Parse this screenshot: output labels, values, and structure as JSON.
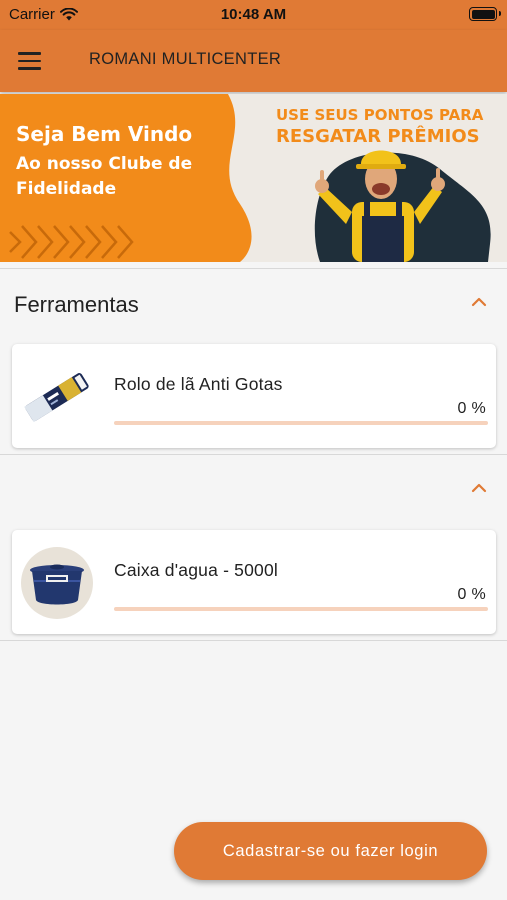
{
  "status_bar": {
    "carrier": "Carrier",
    "time": "10:48 AM"
  },
  "app_bar": {
    "title": "ROMANI MULTICENTER",
    "menu_icon": "hamburger-menu-icon"
  },
  "banner": {
    "left_line1": "Seja Bem Vindo",
    "left_line2": "Ao nosso Clube de",
    "left_line3": "Fidelidade",
    "right_line1": "USE SEUS PONTOS PARA",
    "right_line2": "RESGATAR PRÊMIOS",
    "colors": {
      "orange": "#f28b1a",
      "dark": "#1f2f3a",
      "bg": "#eeeae4"
    }
  },
  "sections": [
    {
      "title": "Ferramentas",
      "expanded_icon": "chevron-up-icon",
      "items": [
        {
          "name": "Rolo de lã Anti Gotas",
          "percent_label": "0 %",
          "progress": 0,
          "image": "paint-roller-package"
        }
      ]
    },
    {
      "title": "",
      "expanded_icon": "chevron-up-icon",
      "items": [
        {
          "name": "Caixa d'agua - 5000l",
          "percent_label": "0 %",
          "progress": 0,
          "image": "water-tank"
        }
      ]
    }
  ],
  "fab": {
    "label": "Cadastrar-se ou fazer login"
  },
  "colors": {
    "primary": "#e07a35",
    "progress_track": "#f6d2bc",
    "background": "#f5f5f5"
  }
}
